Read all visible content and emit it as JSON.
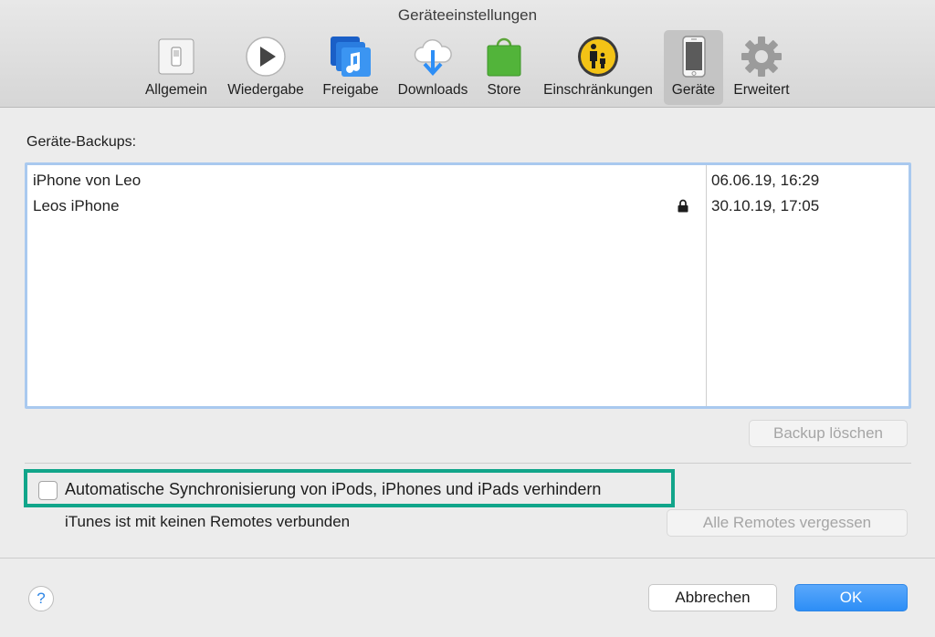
{
  "window": {
    "title": "Geräteeinstellungen"
  },
  "toolbar": {
    "items": [
      {
        "label": "Allgemein",
        "icon": "general-switch-icon",
        "selected": false
      },
      {
        "label": "Wiedergabe",
        "icon": "play-icon",
        "selected": false
      },
      {
        "label": "Freigabe",
        "icon": "sharing-music-icon",
        "selected": false
      },
      {
        "label": "Downloads",
        "icon": "cloud-download-icon",
        "selected": false
      },
      {
        "label": "Store",
        "icon": "store-bag-icon",
        "selected": false
      },
      {
        "label": "Einschränkungen",
        "icon": "parental-controls-icon",
        "selected": false
      },
      {
        "label": "Geräte",
        "icon": "iphone-icon",
        "selected": true
      },
      {
        "label": "Erweitert",
        "icon": "gear-icon",
        "selected": false
      }
    ]
  },
  "backups": {
    "label": "Geräte-Backups:",
    "rows": [
      {
        "name": "iPhone von Leo",
        "date": "06.06.19, 16:29",
        "locked": false
      },
      {
        "name": "Leos iPhone",
        "date": "30.10.19, 17:05",
        "locked": true
      }
    ],
    "delete_button": "Backup löschen"
  },
  "sync": {
    "checkbox_label": "Automatische Synchronisierung von iPods, iPhones und iPads verhindern",
    "checked": false
  },
  "remotes": {
    "status": "iTunes ist mit keinen Remotes verbunden",
    "forget_button": "Alle Remotes vergessen"
  },
  "footer": {
    "help": "?",
    "cancel": "Abbrechen",
    "ok": "OK"
  },
  "colors": {
    "accent": "#2d8ef6",
    "highlight": "#11a58a",
    "selection_border": "#a9c9ef"
  }
}
